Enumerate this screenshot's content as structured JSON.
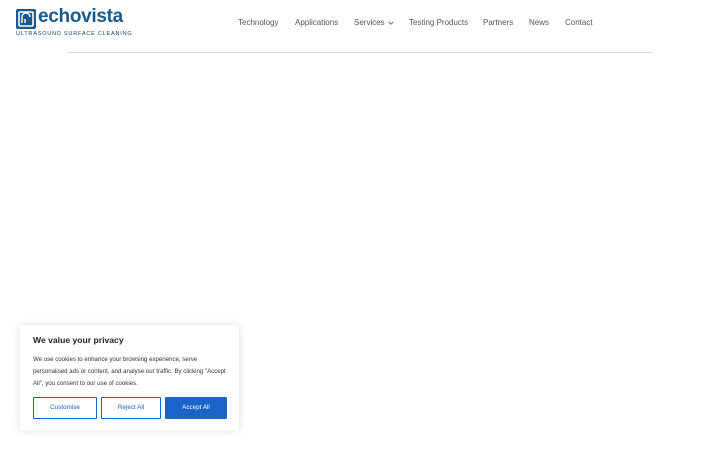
{
  "brand": {
    "name": "echovista",
    "tagline": "ULTRASOUND SURFACE CLEANING",
    "primary_color": "#1a5a8c",
    "accent_color": "#1a63c9"
  },
  "nav": {
    "items": [
      {
        "label": "Technology"
      },
      {
        "label": "Applications"
      },
      {
        "label": "Services",
        "has_dropdown": true,
        "icon": "chevron-down-icon"
      },
      {
        "label": "Testing Products"
      },
      {
        "label": "Partners"
      },
      {
        "label": "News"
      },
      {
        "label": "Contact"
      }
    ]
  },
  "cookie_banner": {
    "title": "We value your privacy",
    "body": "We use cookies to enhance your browsing experience, serve personalised ads or content, and analyse our traffic. By clicking \"Accept All\", you consent to our use of cookies.",
    "buttons": {
      "customise": "Customise",
      "reject": "Reject All",
      "accept": "Accept All"
    }
  }
}
